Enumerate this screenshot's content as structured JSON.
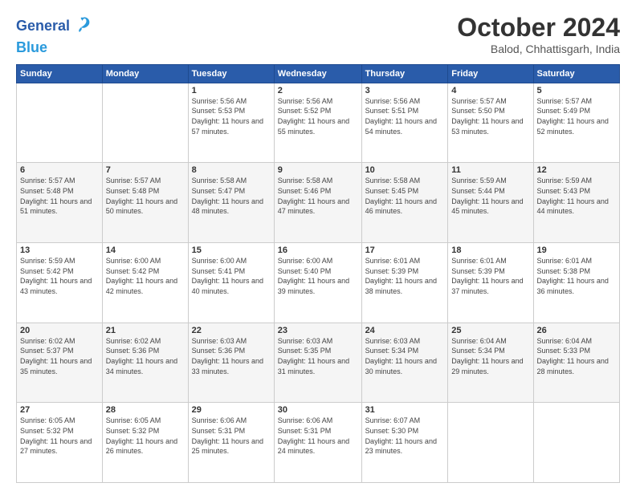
{
  "logo": {
    "line1": "General",
    "line2": "Blue"
  },
  "header": {
    "month": "October 2024",
    "location": "Balod, Chhattisgarh, India"
  },
  "days_of_week": [
    "Sunday",
    "Monday",
    "Tuesday",
    "Wednesday",
    "Thursday",
    "Friday",
    "Saturday"
  ],
  "weeks": [
    [
      {
        "day": "",
        "info": ""
      },
      {
        "day": "",
        "info": ""
      },
      {
        "day": "1",
        "info": "Sunrise: 5:56 AM\nSunset: 5:53 PM\nDaylight: 11 hours and 57 minutes."
      },
      {
        "day": "2",
        "info": "Sunrise: 5:56 AM\nSunset: 5:52 PM\nDaylight: 11 hours and 55 minutes."
      },
      {
        "day": "3",
        "info": "Sunrise: 5:56 AM\nSunset: 5:51 PM\nDaylight: 11 hours and 54 minutes."
      },
      {
        "day": "4",
        "info": "Sunrise: 5:57 AM\nSunset: 5:50 PM\nDaylight: 11 hours and 53 minutes."
      },
      {
        "day": "5",
        "info": "Sunrise: 5:57 AM\nSunset: 5:49 PM\nDaylight: 11 hours and 52 minutes."
      }
    ],
    [
      {
        "day": "6",
        "info": "Sunrise: 5:57 AM\nSunset: 5:48 PM\nDaylight: 11 hours and 51 minutes."
      },
      {
        "day": "7",
        "info": "Sunrise: 5:57 AM\nSunset: 5:48 PM\nDaylight: 11 hours and 50 minutes."
      },
      {
        "day": "8",
        "info": "Sunrise: 5:58 AM\nSunset: 5:47 PM\nDaylight: 11 hours and 48 minutes."
      },
      {
        "day": "9",
        "info": "Sunrise: 5:58 AM\nSunset: 5:46 PM\nDaylight: 11 hours and 47 minutes."
      },
      {
        "day": "10",
        "info": "Sunrise: 5:58 AM\nSunset: 5:45 PM\nDaylight: 11 hours and 46 minutes."
      },
      {
        "day": "11",
        "info": "Sunrise: 5:59 AM\nSunset: 5:44 PM\nDaylight: 11 hours and 45 minutes."
      },
      {
        "day": "12",
        "info": "Sunrise: 5:59 AM\nSunset: 5:43 PM\nDaylight: 11 hours and 44 minutes."
      }
    ],
    [
      {
        "day": "13",
        "info": "Sunrise: 5:59 AM\nSunset: 5:42 PM\nDaylight: 11 hours and 43 minutes."
      },
      {
        "day": "14",
        "info": "Sunrise: 6:00 AM\nSunset: 5:42 PM\nDaylight: 11 hours and 42 minutes."
      },
      {
        "day": "15",
        "info": "Sunrise: 6:00 AM\nSunset: 5:41 PM\nDaylight: 11 hours and 40 minutes."
      },
      {
        "day": "16",
        "info": "Sunrise: 6:00 AM\nSunset: 5:40 PM\nDaylight: 11 hours and 39 minutes."
      },
      {
        "day": "17",
        "info": "Sunrise: 6:01 AM\nSunset: 5:39 PM\nDaylight: 11 hours and 38 minutes."
      },
      {
        "day": "18",
        "info": "Sunrise: 6:01 AM\nSunset: 5:39 PM\nDaylight: 11 hours and 37 minutes."
      },
      {
        "day": "19",
        "info": "Sunrise: 6:01 AM\nSunset: 5:38 PM\nDaylight: 11 hours and 36 minutes."
      }
    ],
    [
      {
        "day": "20",
        "info": "Sunrise: 6:02 AM\nSunset: 5:37 PM\nDaylight: 11 hours and 35 minutes."
      },
      {
        "day": "21",
        "info": "Sunrise: 6:02 AM\nSunset: 5:36 PM\nDaylight: 11 hours and 34 minutes."
      },
      {
        "day": "22",
        "info": "Sunrise: 6:03 AM\nSunset: 5:36 PM\nDaylight: 11 hours and 33 minutes."
      },
      {
        "day": "23",
        "info": "Sunrise: 6:03 AM\nSunset: 5:35 PM\nDaylight: 11 hours and 31 minutes."
      },
      {
        "day": "24",
        "info": "Sunrise: 6:03 AM\nSunset: 5:34 PM\nDaylight: 11 hours and 30 minutes."
      },
      {
        "day": "25",
        "info": "Sunrise: 6:04 AM\nSunset: 5:34 PM\nDaylight: 11 hours and 29 minutes."
      },
      {
        "day": "26",
        "info": "Sunrise: 6:04 AM\nSunset: 5:33 PM\nDaylight: 11 hours and 28 minutes."
      }
    ],
    [
      {
        "day": "27",
        "info": "Sunrise: 6:05 AM\nSunset: 5:32 PM\nDaylight: 11 hours and 27 minutes."
      },
      {
        "day": "28",
        "info": "Sunrise: 6:05 AM\nSunset: 5:32 PM\nDaylight: 11 hours and 26 minutes."
      },
      {
        "day": "29",
        "info": "Sunrise: 6:06 AM\nSunset: 5:31 PM\nDaylight: 11 hours and 25 minutes."
      },
      {
        "day": "30",
        "info": "Sunrise: 6:06 AM\nSunset: 5:31 PM\nDaylight: 11 hours and 24 minutes."
      },
      {
        "day": "31",
        "info": "Sunrise: 6:07 AM\nSunset: 5:30 PM\nDaylight: 11 hours and 23 minutes."
      },
      {
        "day": "",
        "info": ""
      },
      {
        "day": "",
        "info": ""
      }
    ]
  ]
}
